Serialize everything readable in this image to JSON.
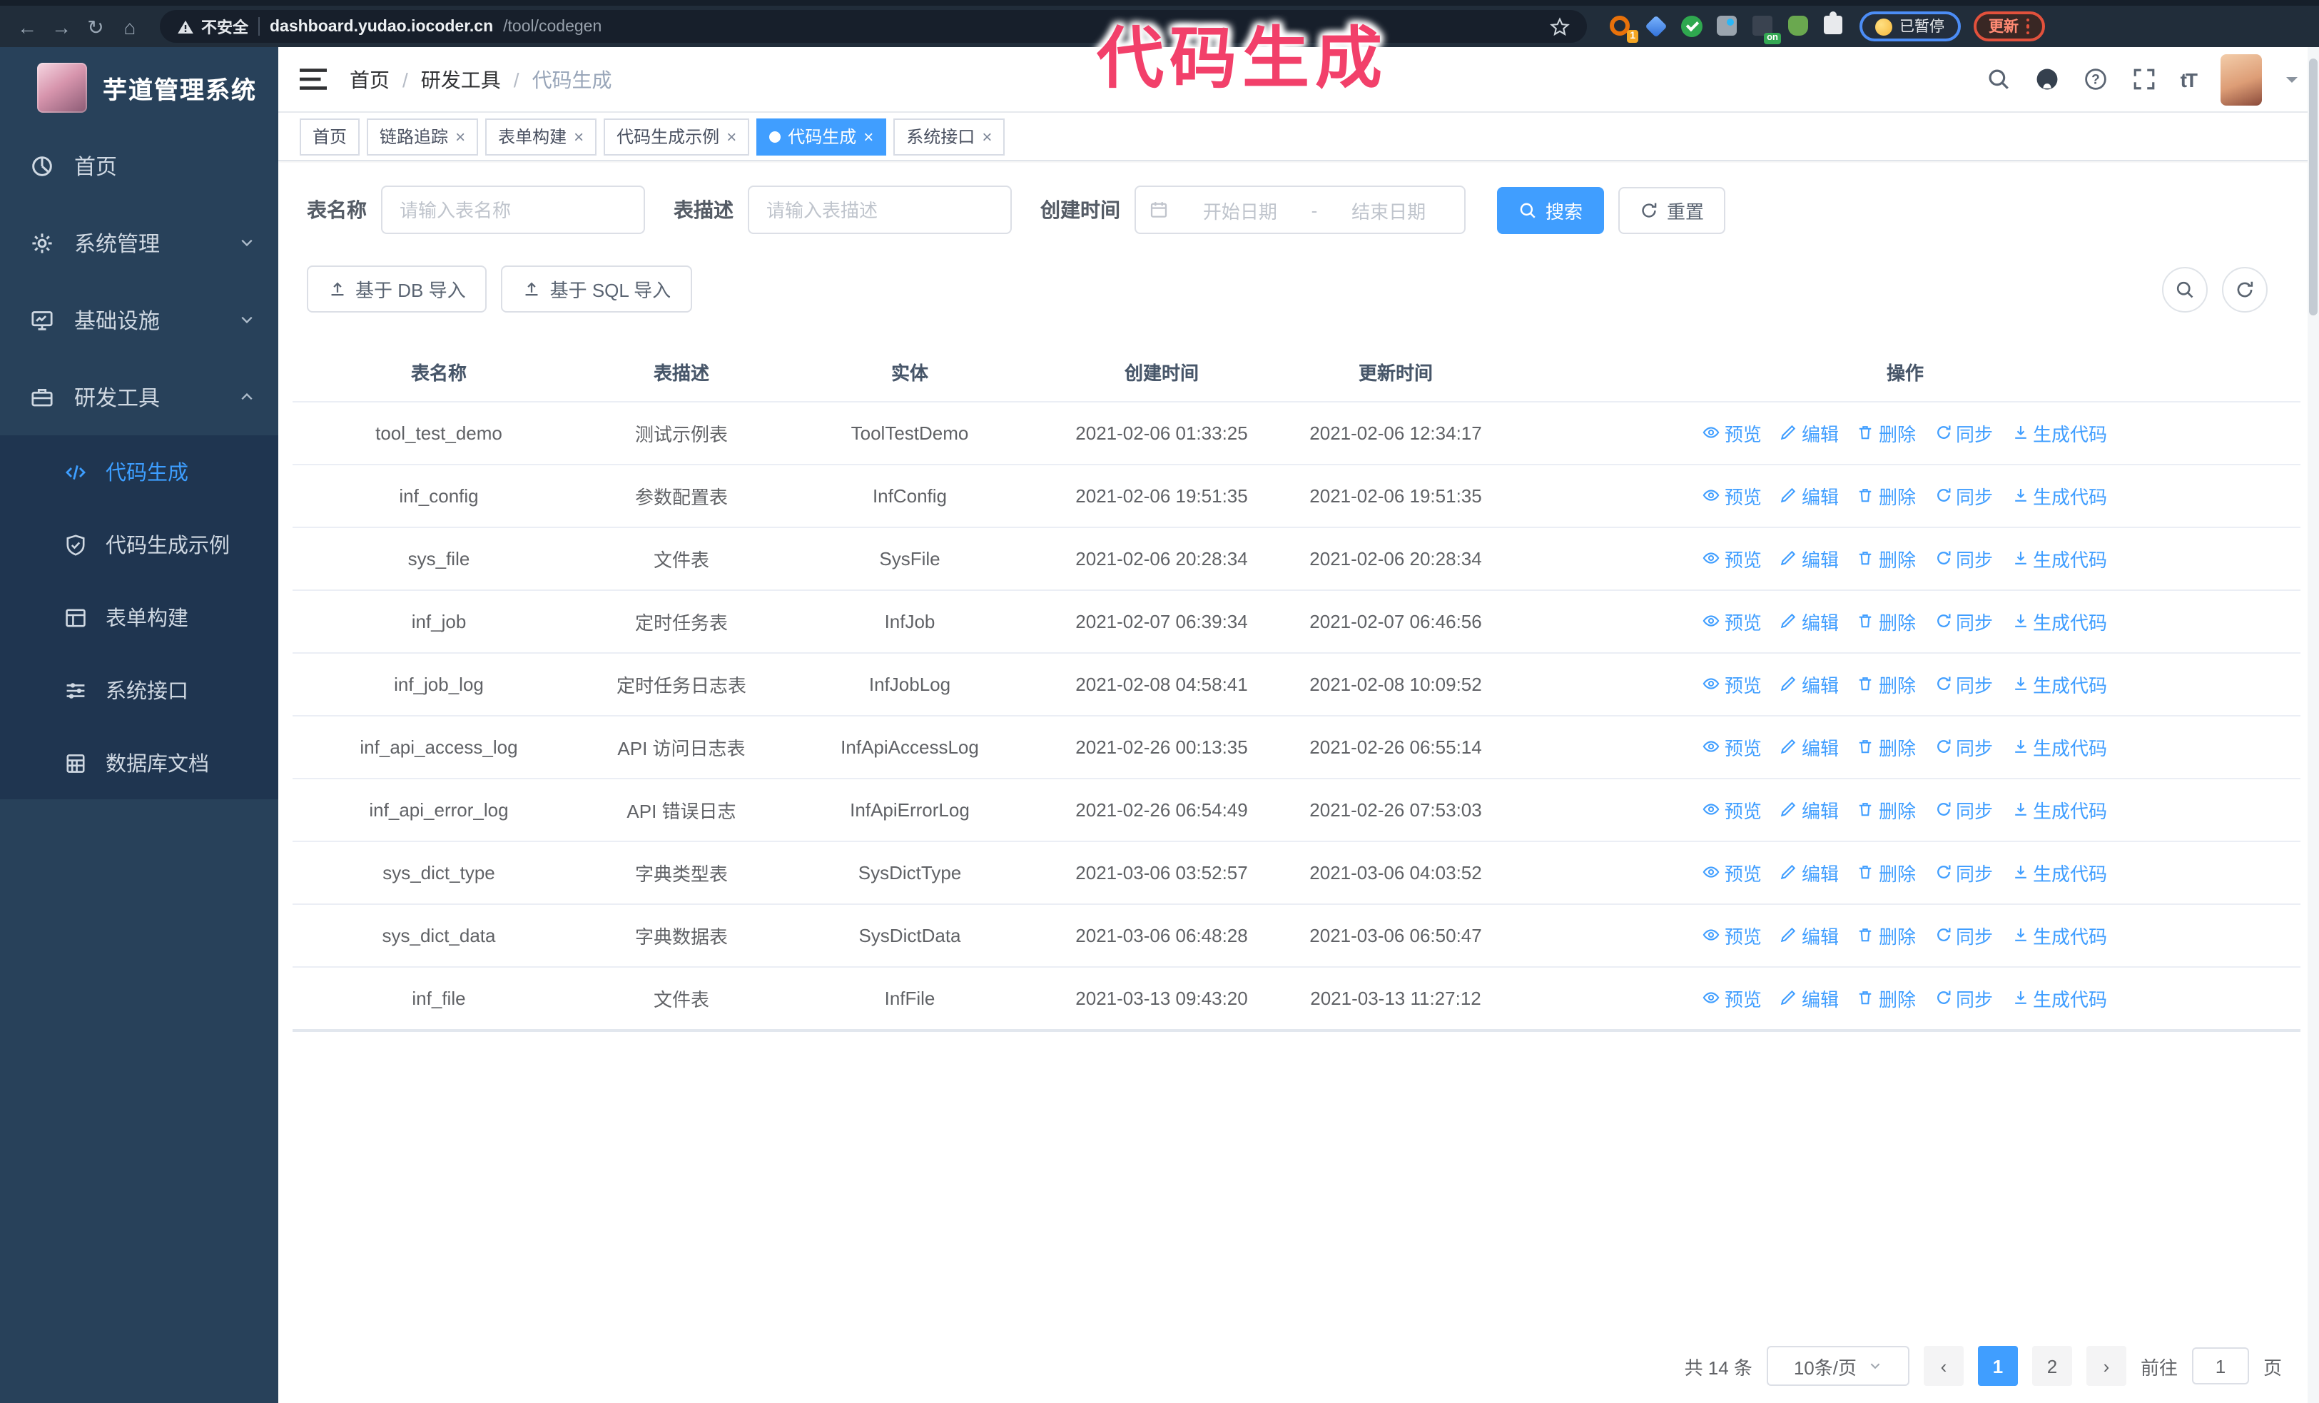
{
  "browser": {
    "security_label": "不安全",
    "url_host": "dashboard.yudao.iocoder.cn",
    "url_path": "/tool/codegen",
    "extensions_badge": "1",
    "on_badge": "on",
    "paused_label": "已暂停",
    "update_label": "更新"
  },
  "watermark": {
    "text": "代码生成",
    "color": "#f2406a"
  },
  "sidebar": {
    "title": "芋道管理系统",
    "items": [
      {
        "label": "首页",
        "icon": "dashboard-icon",
        "expandable": false
      },
      {
        "label": "系统管理",
        "icon": "gear-icon",
        "expandable": true
      },
      {
        "label": "基础设施",
        "icon": "monitor-icon",
        "expandable": true
      },
      {
        "label": "研发工具",
        "icon": "toolbox-icon",
        "expandable": true,
        "expanded": true
      }
    ],
    "sub_items": [
      {
        "label": "代码生成",
        "icon": "code-icon",
        "active": true
      },
      {
        "label": "代码生成示例",
        "icon": "shield-check-icon",
        "active": false
      },
      {
        "label": "表单构建",
        "icon": "form-icon",
        "active": false
      },
      {
        "label": "系统接口",
        "icon": "sliders-icon",
        "active": false
      },
      {
        "label": "数据库文档",
        "icon": "database-icon",
        "active": false
      }
    ]
  },
  "breadcrumb": {
    "separator": "/",
    "items": [
      "首页",
      "研发工具",
      "代码生成"
    ]
  },
  "tabs": [
    {
      "label": "首页",
      "closable": false,
      "active": false
    },
    {
      "label": "链路追踪",
      "closable": true,
      "active": false
    },
    {
      "label": "表单构建",
      "closable": true,
      "active": false
    },
    {
      "label": "代码生成示例",
      "closable": true,
      "active": false
    },
    {
      "label": "代码生成",
      "closable": true,
      "active": true
    },
    {
      "label": "系统接口",
      "closable": true,
      "active": false
    }
  ],
  "filters": {
    "table_name_label": "表名称",
    "table_name_placeholder": "请输入表名称",
    "table_desc_label": "表描述",
    "table_desc_placeholder": "请输入表描述",
    "create_time_label": "创建时间",
    "date_start_placeholder": "开始日期",
    "date_separator": "-",
    "date_end_placeholder": "结束日期",
    "search_label": "搜索",
    "reset_label": "重置"
  },
  "toolbar": {
    "import_db_label": "基于 DB 导入",
    "import_sql_label": "基于 SQL 导入"
  },
  "table": {
    "columns": [
      "表名称",
      "表描述",
      "实体",
      "创建时间",
      "更新时间",
      "操作"
    ],
    "actions": [
      {
        "label": "预览",
        "icon": "eye-icon"
      },
      {
        "label": "编辑",
        "icon": "edit-icon"
      },
      {
        "label": "删除",
        "icon": "delete-icon"
      },
      {
        "label": "同步",
        "icon": "sync-icon"
      },
      {
        "label": "生成代码",
        "icon": "download-icon"
      }
    ],
    "rows": [
      {
        "name": "tool_test_demo",
        "desc": "测试示例表",
        "entity": "ToolTestDemo",
        "create_time": "2021-02-06 01:33:25",
        "update_time": "2021-02-06 12:34:17"
      },
      {
        "name": "inf_config",
        "desc": "参数配置表",
        "entity": "InfConfig",
        "create_time": "2021-02-06 19:51:35",
        "update_time": "2021-02-06 19:51:35"
      },
      {
        "name": "sys_file",
        "desc": "文件表",
        "entity": "SysFile",
        "create_time": "2021-02-06 20:28:34",
        "update_time": "2021-02-06 20:28:34"
      },
      {
        "name": "inf_job",
        "desc": "定时任务表",
        "entity": "InfJob",
        "create_time": "2021-02-07 06:39:34",
        "update_time": "2021-02-07 06:46:56"
      },
      {
        "name": "inf_job_log",
        "desc": "定时任务日志表",
        "entity": "InfJobLog",
        "create_time": "2021-02-08 04:58:41",
        "update_time": "2021-02-08 10:09:52"
      },
      {
        "name": "inf_api_access_log",
        "desc": "API 访问日志表",
        "entity": "InfApiAccessLog",
        "create_time": "2021-02-26 00:13:35",
        "update_time": "2021-02-26 06:55:14"
      },
      {
        "name": "inf_api_error_log",
        "desc": "API 错误日志",
        "entity": "InfApiErrorLog",
        "create_time": "2021-02-26 06:54:49",
        "update_time": "2021-02-26 07:53:03"
      },
      {
        "name": "sys_dict_type",
        "desc": "字典类型表",
        "entity": "SysDictType",
        "create_time": "2021-03-06 03:52:57",
        "update_time": "2021-03-06 04:03:52"
      },
      {
        "name": "sys_dict_data",
        "desc": "字典数据表",
        "entity": "SysDictData",
        "create_time": "2021-03-06 06:48:28",
        "update_time": "2021-03-06 06:50:47"
      },
      {
        "name": "inf_file",
        "desc": "文件表",
        "entity": "InfFile",
        "create_time": "2021-03-13 09:43:20",
        "update_time": "2021-03-13 11:27:12"
      }
    ]
  },
  "pagination": {
    "total_label": "共 14 条",
    "page_size": "10条/页",
    "pages": [
      "1",
      "2"
    ],
    "active_page": "1",
    "goto_label": "前往",
    "goto_value": "1",
    "goto_suffix": "页"
  },
  "colors": {
    "accent": "#409eff",
    "watermark": "#f2406a",
    "sidebar_bg": "#28415a",
    "submenu_bg": "#1f3550",
    "chrome_bg": "#212d3a"
  }
}
